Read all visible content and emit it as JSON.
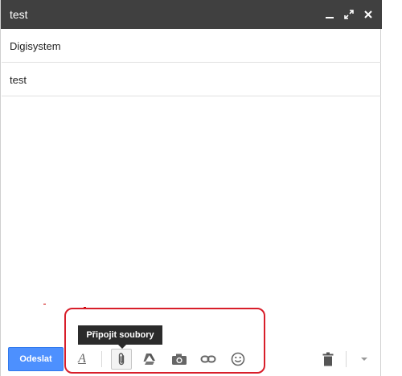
{
  "window": {
    "title": "test",
    "controls": [
      "minimize",
      "pop-out",
      "close"
    ]
  },
  "fields": {
    "recipient": "Digisystem",
    "subject": "test"
  },
  "tooltip": {
    "text": "Připojit soubory"
  },
  "toolbar": {
    "send_label": "Odeslat",
    "tools": [
      "formatting-options",
      "attach-files",
      "google-drive",
      "insert-photo",
      "insert-link",
      "insert-emoticon",
      "discard-draft",
      "more-options"
    ]
  },
  "colors": {
    "titlebar": "#404040",
    "send_button": "#4d90fe",
    "highlight": "#d81e2a",
    "tooltip": "#2b2b2b"
  }
}
